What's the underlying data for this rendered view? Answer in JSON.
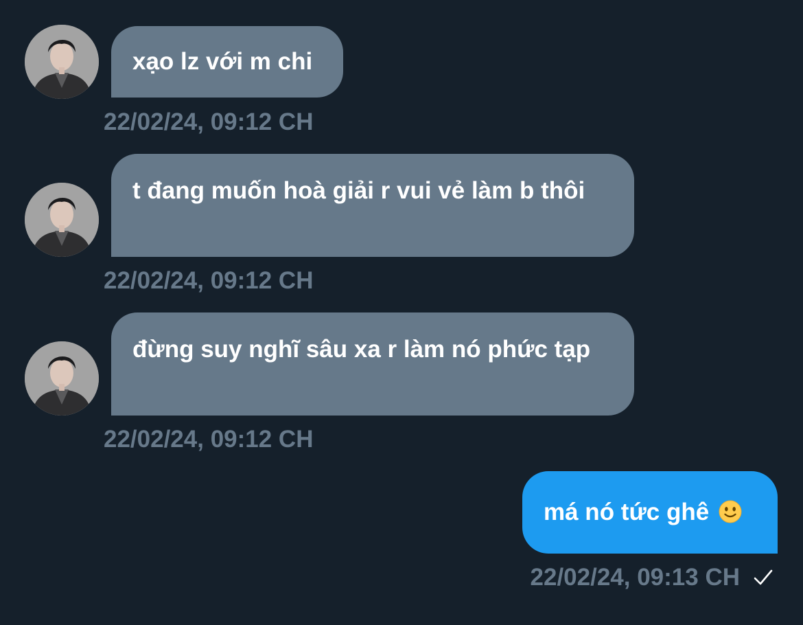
{
  "messages": [
    {
      "sender": "other",
      "avatar_icon": "profile-photo-avatar",
      "text": "xạo lz với m chi",
      "timestamp": "22/02/24, 09:12 CH"
    },
    {
      "sender": "other",
      "avatar_icon": "profile-photo-avatar",
      "text": "t đang muốn hoà giải r vui vẻ làm b thôi",
      "timestamp": "22/02/24, 09:12 CH"
    },
    {
      "sender": "other",
      "avatar_icon": "profile-photo-avatar",
      "text": "đừng suy nghĩ sâu xa r làm nó phức tạp",
      "timestamp": "22/02/24, 09:12 CH"
    },
    {
      "sender": "me",
      "text": "má nó tức ghê",
      "emoji": "slightly-smiling-face-icon",
      "timestamp": "22/02/24, 09:13 CH",
      "status_icon": "sent-check-icon"
    }
  ],
  "colors": {
    "background": "#15202b",
    "incoming_bubble": "#66798a",
    "outgoing_bubble": "#1d9bf0",
    "timestamp_text": "#67798a"
  }
}
